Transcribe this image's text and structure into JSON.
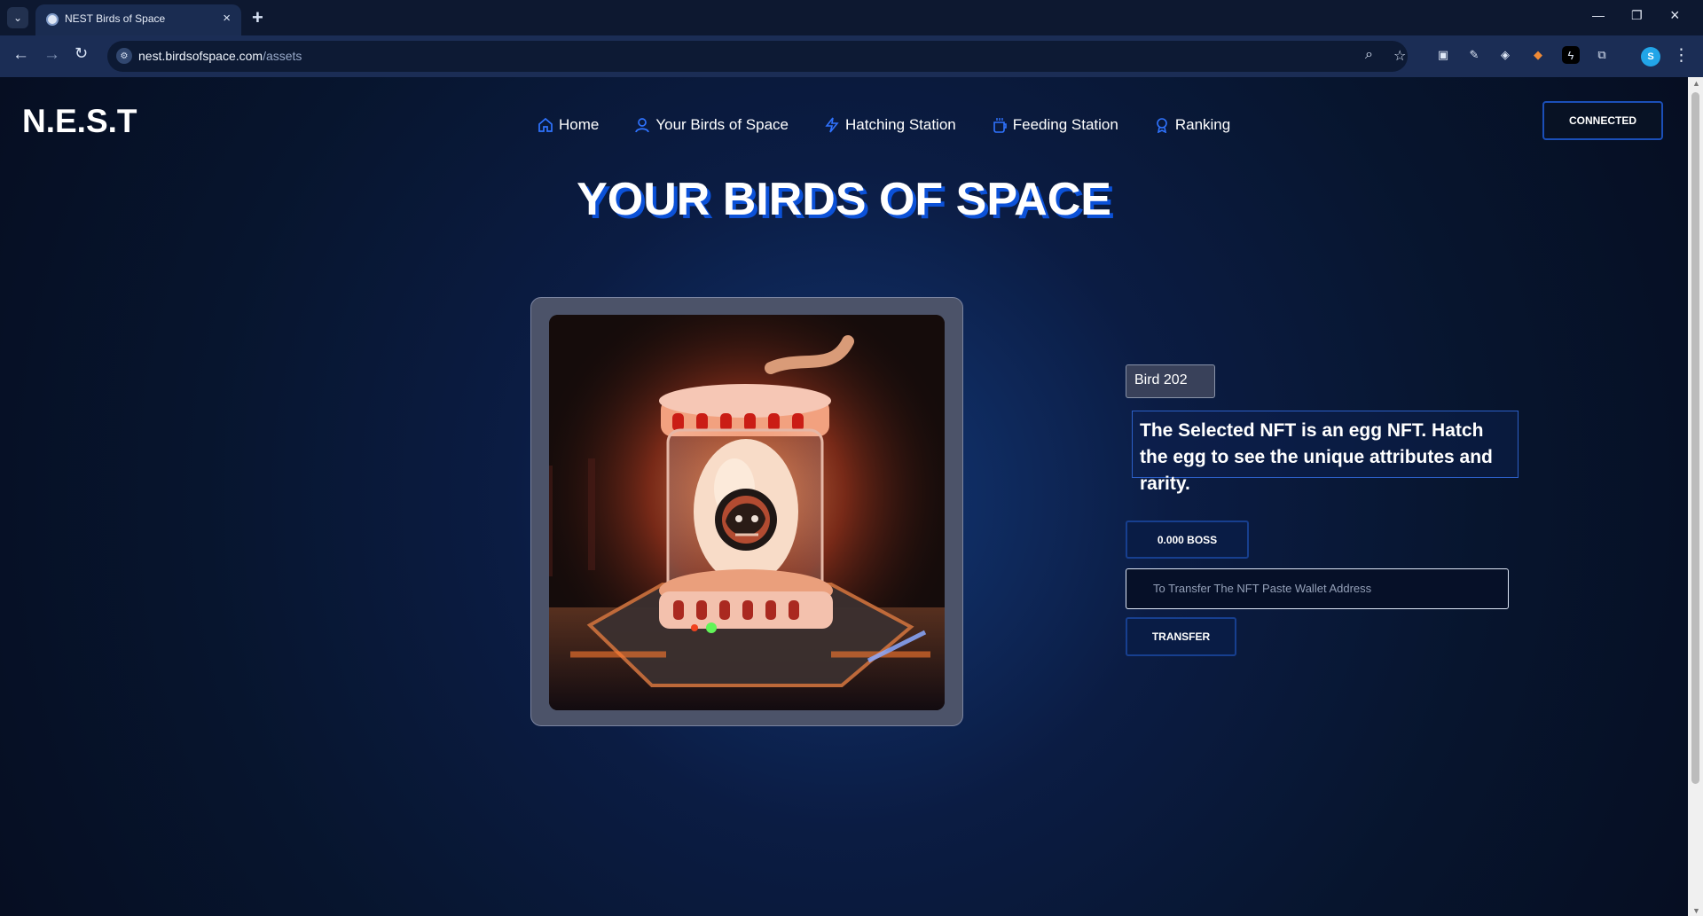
{
  "browser": {
    "tab_title": "NEST Birds of Space",
    "url_domain": "nest.birdsofspace.com",
    "url_path": "/assets"
  },
  "site": {
    "logo": "N.E.S.T",
    "nav": [
      {
        "label": "Home",
        "icon": "home-icon"
      },
      {
        "label": "Your Birds of Space",
        "icon": "user-icon"
      },
      {
        "label": "Hatching Station",
        "icon": "lightning-icon"
      },
      {
        "label": "Feeding Station",
        "icon": "cup-icon"
      },
      {
        "label": "Ranking",
        "icon": "award-icon"
      }
    ],
    "wallet_status": "CONNECTED"
  },
  "main": {
    "title": "YOUR BIRDS OF SPACE",
    "bird_name": "Bird 202",
    "message": "The Selected NFT is an egg NFT. Hatch the egg to see the unique attributes and rarity.",
    "boss_balance": "0.000 BOSS",
    "transfer_placeholder": "To Transfer The NFT Paste Wallet Address",
    "transfer_label": "TRANSFER"
  },
  "colors": {
    "page_background": "#0b1226",
    "accent_blue": "#2f73ff",
    "button_border": "#173f8f",
    "egg_art_orange": "#d65c32"
  }
}
